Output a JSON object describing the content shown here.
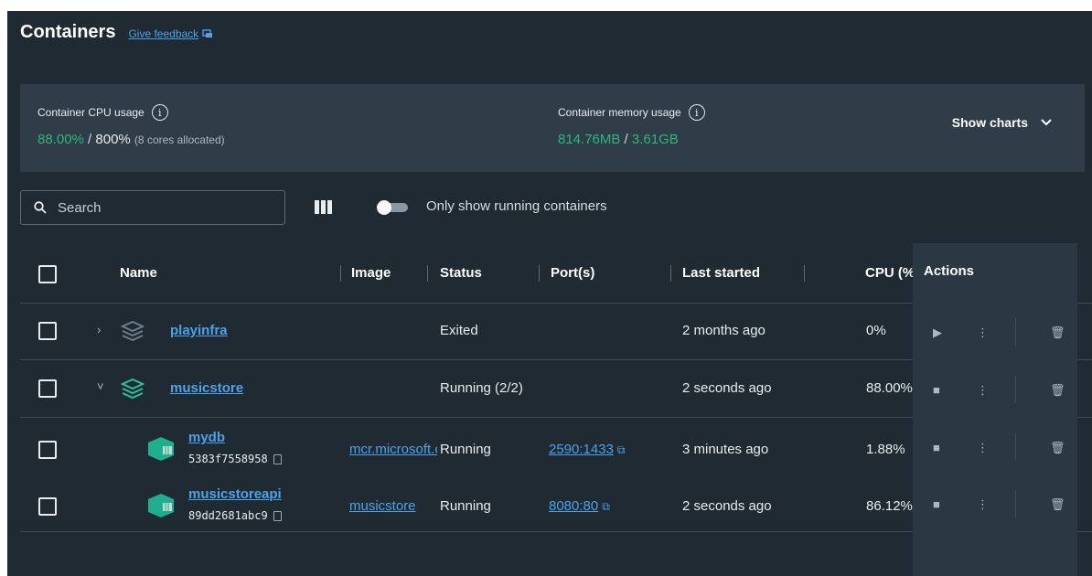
{
  "header": {
    "title": "Containers",
    "feedback_label": "Give feedback"
  },
  "stats": {
    "cpu_label": "Container CPU usage",
    "cpu_value": "88.00%",
    "cpu_sep": " / ",
    "cpu_total": "800%",
    "cpu_note": "(8 cores allocated)",
    "mem_label": "Container memory usage",
    "mem_value": "814.76MB",
    "mem_sep": " / ",
    "mem_total": "3.61GB",
    "show_charts_label": "Show charts"
  },
  "toolbar": {
    "search_placeholder": "Search",
    "toggle_label": "Only show running containers"
  },
  "table": {
    "columns": [
      "Name",
      "Image",
      "Status",
      "Port(s)",
      "Last started",
      "CPU (%)",
      "Actions"
    ],
    "rows": [
      {
        "name": "playinfra",
        "status": "Exited",
        "last_started": "2 months ago",
        "cpu": "0%"
      },
      {
        "name": "musicstore",
        "status": "Running (2/2)",
        "last_started": "2 seconds ago",
        "cpu": "88.00%"
      },
      {
        "name": "mydb",
        "id": "5383f7558958",
        "image": "mcr.microsoft.com/mssql/server",
        "status": "Running",
        "port": "2590:1433",
        "last_started": "3 minutes ago",
        "cpu": "1.88%"
      },
      {
        "name": "musicstoreapi",
        "id": "89dd2681abc9",
        "image": "musicstore",
        "status": "Running",
        "port": "8080:80",
        "last_started": "2 seconds ago",
        "cpu": "86.12%"
      }
    ]
  },
  "colors": {
    "accent_link": "#4ba3ea",
    "green_value": "#2fb57c",
    "background": "#1f2a32",
    "stats_bg": "#2e3d48"
  }
}
